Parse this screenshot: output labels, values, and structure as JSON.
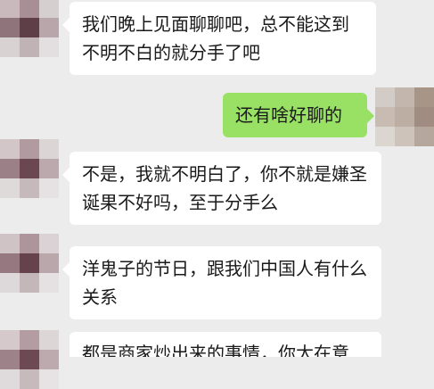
{
  "messages": [
    {
      "side": "in",
      "text": "我们晚上见面聊聊吧，总不能这到不明不白的就分手了吧"
    },
    {
      "side": "out",
      "text": "还有啥好聊的"
    },
    {
      "side": "in",
      "text": "不是，我就不明白了，你不就是嫌圣诞果不好吗，至于分手么"
    },
    {
      "side": "in",
      "text": "洋鬼子的节日，跟我们中国人有什么关系"
    },
    {
      "side": "in",
      "text": "都是商家炒出来的事情，你太在意"
    }
  ],
  "colors": {
    "background": "#ececec",
    "incoming_bubble": "#ffffff",
    "outgoing_bubble": "#98e165"
  }
}
